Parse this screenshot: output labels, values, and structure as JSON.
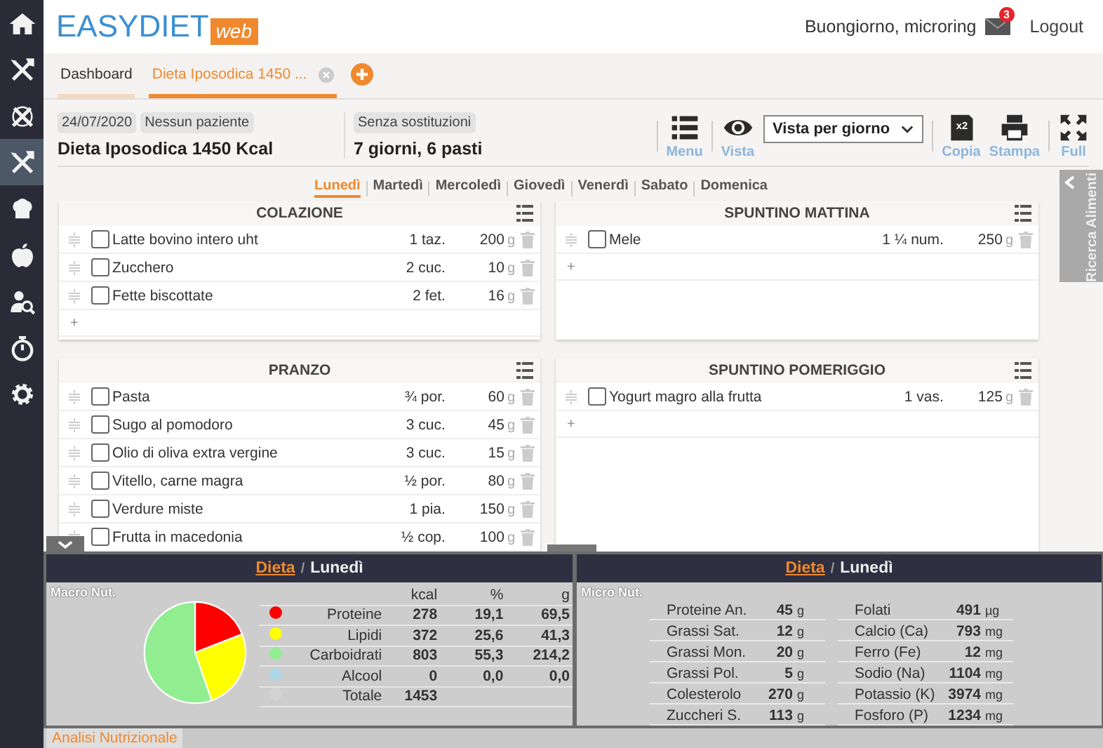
{
  "header": {
    "logo_text": "EASYDIET",
    "logo_badge": "web",
    "greeting": "Buongiorno, microring",
    "mail_count": "3",
    "logout": "Logout"
  },
  "sidebar": {
    "items": [
      {
        "kind": "home",
        "selected": false
      },
      {
        "kind": "cutlery",
        "selected": false
      },
      {
        "kind": "cutlery-ring",
        "selected": false
      },
      {
        "kind": "cutlery",
        "selected": true
      },
      {
        "kind": "chef",
        "selected": false
      },
      {
        "kind": "apple",
        "selected": false
      },
      {
        "kind": "search-person",
        "selected": false
      },
      {
        "kind": "stopwatch",
        "selected": false
      },
      {
        "kind": "gear",
        "selected": false
      }
    ]
  },
  "tabs": [
    {
      "label": "Dashboard",
      "selected": false,
      "closable": false
    },
    {
      "label": "Dieta Iposodica 1450 ...",
      "selected": true,
      "closable": true
    }
  ],
  "diet": {
    "date": "24/07/2020",
    "patient": "Nessun paziente",
    "title": "Dieta Iposodica 1450 Kcal",
    "substitutions": "Senza sostituzioni",
    "summary": "7 giorni, 6 pasti"
  },
  "toolbar": [
    {
      "kind": "menu",
      "label": "Menu"
    },
    {
      "kind": "view",
      "label": "Vista"
    },
    {
      "kind": "select",
      "value": "Vista per giorno"
    },
    {
      "kind": "copy",
      "label": "Copia",
      "badge": "x2"
    },
    {
      "kind": "print",
      "label": "Stampa"
    },
    {
      "kind": "full",
      "label": "Full"
    }
  ],
  "days": [
    {
      "label": "Lunedì",
      "selected": true
    },
    {
      "label": "Martedì",
      "selected": false
    },
    {
      "label": "Mercoledì",
      "selected": false
    },
    {
      "label": "Giovedì",
      "selected": false
    },
    {
      "label": "Venerdì",
      "selected": false
    },
    {
      "label": "Sabato",
      "selected": false
    },
    {
      "label": "Domenica",
      "selected": false
    }
  ],
  "meals": [
    {
      "title": "COLAZIONE",
      "add": "+",
      "items": [
        {
          "name": "Latte bovino intero uht",
          "qty": "1 taz.",
          "amount": "200",
          "unit": "g",
          "checked": false
        },
        {
          "name": "Zucchero",
          "qty": "2 cuc.",
          "amount": "10",
          "unit": "g",
          "checked": false
        },
        {
          "name": "Fette biscottate",
          "qty": "2 fet.",
          "amount": "16",
          "unit": "g",
          "checked": false
        }
      ]
    },
    {
      "title": "SPUNTINO MATTINA",
      "add": "+",
      "items": [
        {
          "name": "Mele",
          "qty": "1 ¼ num.",
          "amount": "250",
          "unit": "g",
          "checked": false
        }
      ]
    },
    {
      "title": "PRANZO",
      "items": [
        {
          "name": "Pasta",
          "qty": "¾ por.",
          "amount": "60",
          "unit": "g",
          "checked": false
        },
        {
          "name": "Sugo al pomodoro",
          "qty": "3 cuc.",
          "amount": "45",
          "unit": "g",
          "checked": false
        },
        {
          "name": "Olio di oliva extra vergine",
          "qty": "3 cuc.",
          "amount": "15",
          "unit": "g",
          "checked": false
        },
        {
          "name": "Vitello, carne magra",
          "qty": "½ por.",
          "amount": "80",
          "unit": "g",
          "checked": false
        },
        {
          "name": "Verdure miste",
          "qty": "1 pia.",
          "amount": "150",
          "unit": "g",
          "checked": false
        },
        {
          "name": "Frutta in macedonia",
          "qty": "½ cop.",
          "amount": "100",
          "unit": "g",
          "checked": false
        }
      ]
    },
    {
      "title": "SPUNTINO POMERIGGIO",
      "add": "+",
      "items": [
        {
          "name": "Yogurt magro alla frutta",
          "qty": "1 vas.",
          "amount": "125",
          "unit": "g",
          "checked": false
        }
      ]
    }
  ],
  "side_tab": {
    "label": "Ricerca Alimenti"
  },
  "analysis": {
    "macro": {
      "crumb": "Dieta",
      "separator": "/",
      "day": "Lunedì",
      "label": "Macro Nut.",
      "columns": [
        "kcal",
        "%",
        "g"
      ],
      "pie": {
        "kind": "pie"
      },
      "rows": [
        {
          "name": "Proteine",
          "color": "#ff0000",
          "kcal": "278",
          "pct": "19,1",
          "g": "69,5"
        },
        {
          "name": "Lipidi",
          "color": "#ffff00",
          "kcal": "372",
          "pct": "25,6",
          "g": "41,3"
        },
        {
          "name": "Carboidrati",
          "color": "#90ee90",
          "kcal": "803",
          "pct": "55,3",
          "g": "214,2"
        },
        {
          "name": "Alcool",
          "color": "#add8e6",
          "kcal": "0",
          "pct": "0,0",
          "g": "0,0"
        },
        {
          "name": "Totale",
          "color": "#d3d3d3",
          "kcal": "1453"
        }
      ]
    },
    "micro": {
      "crumb": "Dieta",
      "separator": "/",
      "day": "Lunedì",
      "label": "Micro Nut.",
      "columns": [
        [
          {
            "name": "Proteine An.",
            "value": "45",
            "unit": "g"
          },
          {
            "name": "Grassi Sat.",
            "value": "12",
            "unit": "g"
          },
          {
            "name": "Grassi Mon.",
            "value": "20",
            "unit": "g"
          },
          {
            "name": "Grassi Pol.",
            "value": "5",
            "unit": "g"
          },
          {
            "name": "Colesterolo",
            "value": "270",
            "unit": "g"
          },
          {
            "name": "Zuccheri S.",
            "value": "113",
            "unit": "g"
          }
        ],
        [
          {
            "name": "Folati",
            "value": "491",
            "unit": "µg"
          },
          {
            "name": "Calcio (Ca)",
            "value": "793",
            "unit": "mg"
          },
          {
            "name": "Ferro (Fe)",
            "value": "12",
            "unit": "mg"
          },
          {
            "name": "Sodio (Na)",
            "value": "1104",
            "unit": "mg"
          },
          {
            "name": "Potassio (K)",
            "value": "3974",
            "unit": "mg"
          },
          {
            "name": "Fosforo (P)",
            "value": "1234",
            "unit": "mg"
          }
        ]
      ]
    },
    "footer_tabs": [
      {
        "label": "Analisi Nutrizionale",
        "selected": true
      }
    ]
  }
}
